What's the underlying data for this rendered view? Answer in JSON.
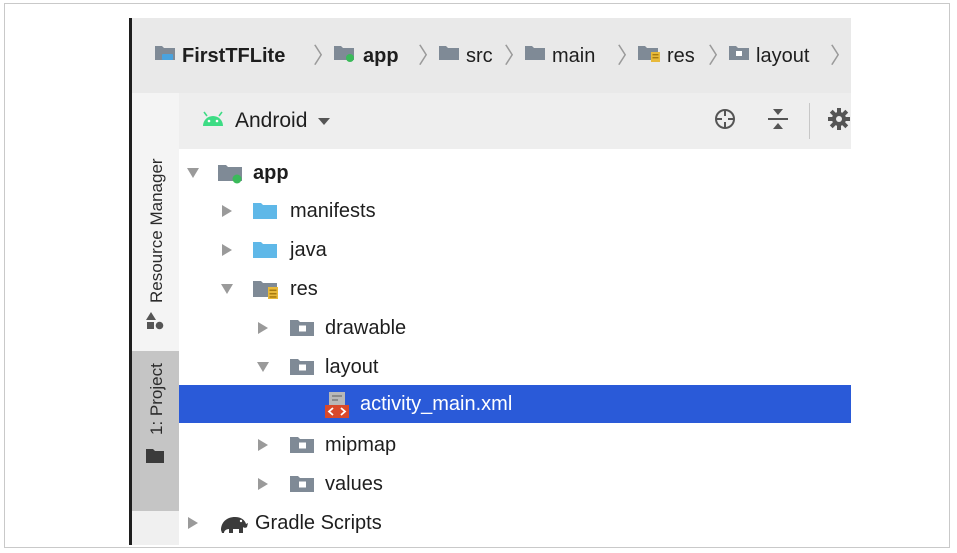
{
  "breadcrumb": {
    "items": [
      {
        "label": "FirstTFLite",
        "icon": "project-module-icon"
      },
      {
        "label": "app",
        "icon": "app-module-icon"
      },
      {
        "label": "src",
        "icon": "folder-icon"
      },
      {
        "label": "main",
        "icon": "folder-icon"
      },
      {
        "label": "res",
        "icon": "resource-folder-icon"
      },
      {
        "label": "layout",
        "icon": "package-folder-icon"
      }
    ],
    "separator": "〉"
  },
  "side_strip": {
    "resource_manager_label": "Resource Manager",
    "project_label": "1: Project"
  },
  "toolbar": {
    "view_label": "Android",
    "view_icon": "android-icon",
    "buttons": [
      "locate-icon",
      "collapse-all-icon",
      "gear-icon"
    ]
  },
  "tree": {
    "rows": [
      {
        "label": "app",
        "level": 0,
        "expanded": true,
        "icon": "app-module-icon",
        "selected": false
      },
      {
        "label": "manifests",
        "level": 1,
        "expanded": false,
        "icon": "folder-icon",
        "selected": false
      },
      {
        "label": "java",
        "level": 1,
        "expanded": false,
        "icon": "folder-icon",
        "selected": false
      },
      {
        "label": "res",
        "level": 1,
        "expanded": true,
        "icon": "resource-folder-icon",
        "selected": false
      },
      {
        "label": "drawable",
        "level": 2,
        "expanded": false,
        "icon": "package-folder-icon",
        "selected": false
      },
      {
        "label": "layout",
        "level": 2,
        "expanded": true,
        "icon": "package-folder-icon",
        "selected": false
      },
      {
        "label": "activity_main.xml",
        "level": 3,
        "expanded": null,
        "icon": "layout-xml-file-icon",
        "selected": true
      },
      {
        "label": "mipmap",
        "level": 2,
        "expanded": false,
        "icon": "package-folder-icon",
        "selected": false
      },
      {
        "label": "values",
        "level": 2,
        "expanded": false,
        "icon": "package-folder-icon",
        "selected": false
      },
      {
        "label": "Gradle Scripts",
        "level": 0,
        "expanded": false,
        "icon": "gradle-elephant-icon",
        "selected": false
      }
    ]
  },
  "colors": {
    "selection": "#2a5ad8",
    "folder_blue": "#5fb8e8",
    "android_green": "#3ddc84",
    "module_dot": "#3aba5a"
  }
}
